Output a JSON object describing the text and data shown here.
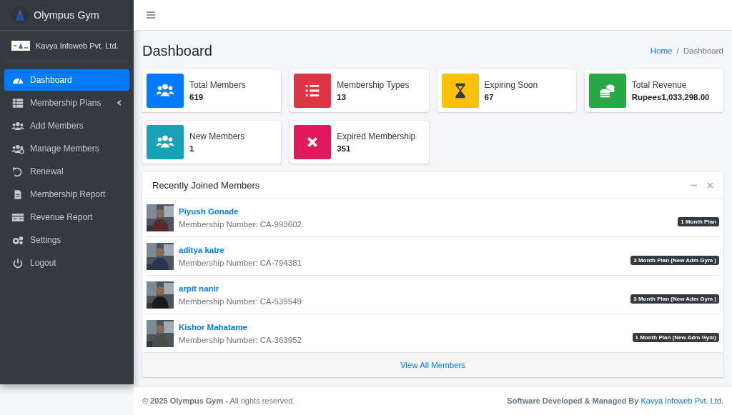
{
  "brand": {
    "name": "Olympus Gym"
  },
  "user": {
    "name": "Kavya Infoweb Pvt. Ltd."
  },
  "nav": [
    {
      "label": "Dashboard",
      "kind": "gauge",
      "selected": true
    },
    {
      "label": "Membership Plans",
      "kind": "table",
      "selected": false,
      "expanded": false
    },
    {
      "label": "Add Members",
      "kind": "users",
      "selected": false
    },
    {
      "label": "Manage Members",
      "kind": "usersgear",
      "selected": false
    },
    {
      "label": "Renewal",
      "kind": "undo",
      "selected": false
    },
    {
      "label": "Membership Report",
      "kind": "file",
      "selected": false
    },
    {
      "label": "Revenue Report",
      "kind": "card",
      "selected": false
    },
    {
      "label": "Settings",
      "kind": "gears",
      "selected": false
    },
    {
      "label": "Logout",
      "kind": "power",
      "selected": false
    }
  ],
  "page_title": "Dashboard",
  "breadcrumb": {
    "separator": "/",
    "items": [
      {
        "label": "Home",
        "active": false
      },
      {
        "label": "Dashboard",
        "active": true
      }
    ]
  },
  "stats": [
    {
      "label": "Total Members",
      "value": "619",
      "kind": "users",
      "color": "#007bff"
    },
    {
      "label": "Membership Types",
      "value": "13",
      "kind": "list",
      "color": "#dc3545"
    },
    {
      "label": "Expiring Soon",
      "value": "67",
      "kind": "hourglass",
      "color": "#ffc107"
    },
    {
      "label": "Total Revenue",
      "value": "Rupees1,033,298.00",
      "kind": "coins",
      "color": "#28a745"
    },
    {
      "label": "New Members",
      "value": "1",
      "kind": "users",
      "color": "#17a2b8"
    },
    {
      "label": "Expired Membership",
      "value": "351",
      "kind": "times",
      "color": "#e0195c"
    }
  ],
  "recent": {
    "title": "Recently Joined Members",
    "members": [
      {
        "name": "Piyush Gonade",
        "number": "Membership Number: CA-993602",
        "plan": "1 Month Plan"
      },
      {
        "name": "aditya katre",
        "number": "Membership Number: CA-794381",
        "plan": "3 Month Plan (New Adm Gym )"
      },
      {
        "name": "arpit nanir",
        "number": "Membership Number: CA-539549",
        "plan": "3 Month Plan (New Adm Gym )"
      },
      {
        "name": "Kishor Mahatame",
        "number": "Membership Number: CA-363952",
        "plan": "1 Month Plan (New Adm Gym)"
      }
    ],
    "footer_link": "View All Members"
  },
  "footer": {
    "left": "**© 2025 Olympus Gym -** All rights reserved.",
    "right": "Software Developed & Managed By",
    "right_link": "Kavya Infoweb Pvt. Ltd."
  }
}
